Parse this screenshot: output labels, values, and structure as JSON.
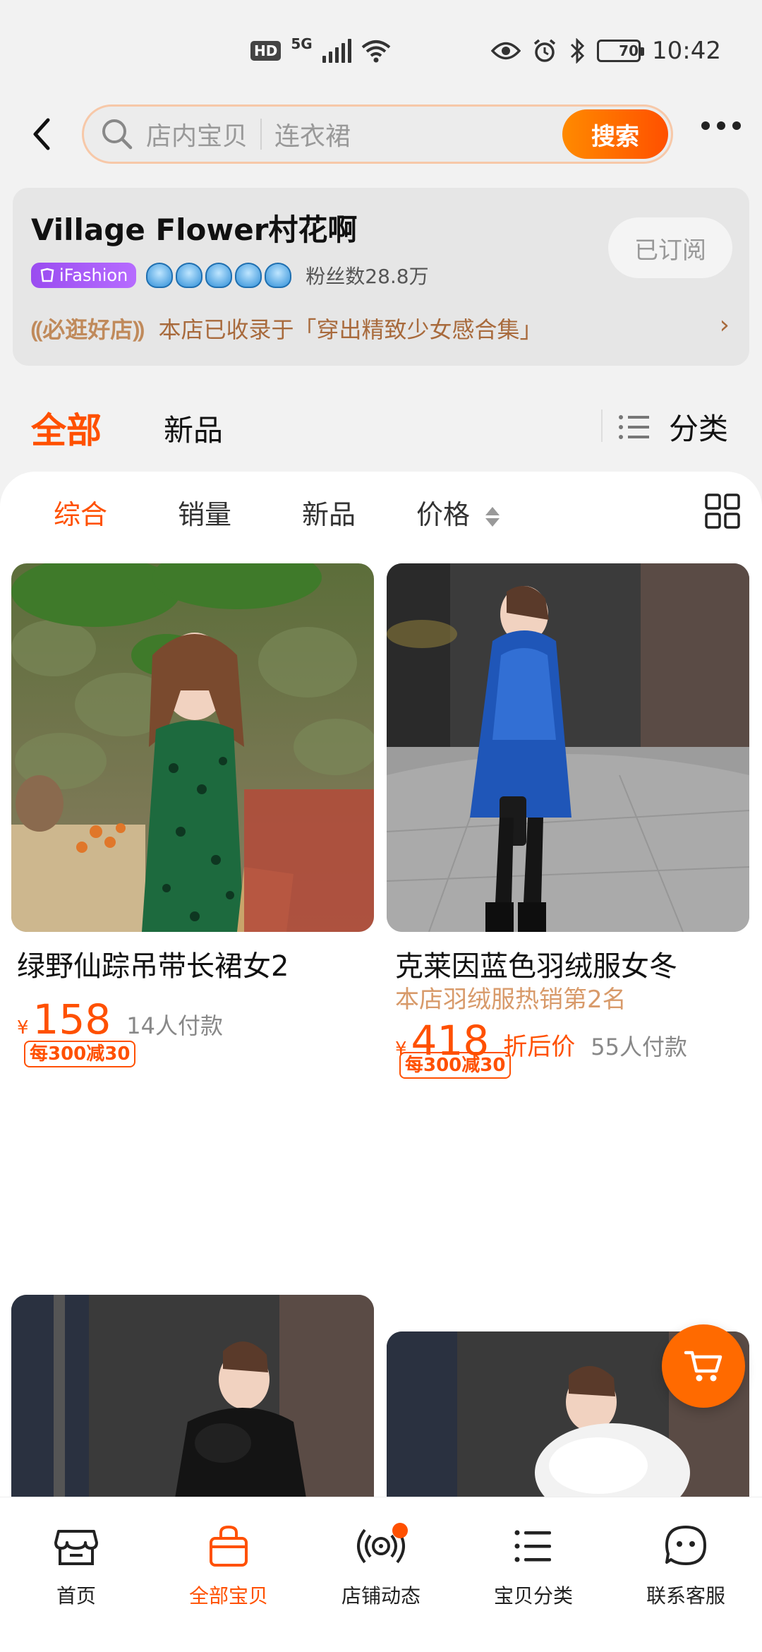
{
  "status_bar": {
    "hd": "HD",
    "network": "5G",
    "battery": "70",
    "battery_level": 0.7,
    "time": "10:42"
  },
  "header": {
    "search_scope": "店内宝贝",
    "search_value": "连衣裙",
    "search_button": "搜索"
  },
  "shop": {
    "name": "Village Flower村花啊",
    "badge": "iFashion",
    "crown_count": 5,
    "fans": "粉丝数28.8万",
    "subscribe_label": "已订阅",
    "promo_tag": "必逛好店",
    "promo_text": "本店已收录于「穿出精致少女感合集」"
  },
  "top_tabs": {
    "all": "全部",
    "new": "新品",
    "category": "分类"
  },
  "sort_bar": {
    "items": [
      "综合",
      "销量",
      "新品",
      "价格"
    ]
  },
  "products": [
    {
      "title": "绿野仙踪吊带长裙女2",
      "currency": "¥",
      "price": "158",
      "buyers": "14人付款",
      "coupon": "每300减30"
    },
    {
      "title": "克莱因蓝色羽绒服女冬",
      "subtitle": "本店羽绒服热销第2名",
      "currency": "¥",
      "price": "418",
      "after_price": "折后价",
      "buyers": "55人付款",
      "coupon": "每300减30"
    }
  ],
  "bottom_nav": {
    "items": [
      {
        "label": "首页",
        "icon": "storefront-icon"
      },
      {
        "label": "全部宝贝",
        "icon": "shopping-bag-icon"
      },
      {
        "label": "店铺动态",
        "icon": "broadcast-icon"
      },
      {
        "label": "宝贝分类",
        "icon": "list-icon"
      },
      {
        "label": "联系客服",
        "icon": "chat-face-icon"
      }
    ],
    "active_index": 1
  },
  "colors": {
    "accent": "#ff5000",
    "promo": "#a86a3c",
    "badge_purple": "#9a4cf0"
  }
}
